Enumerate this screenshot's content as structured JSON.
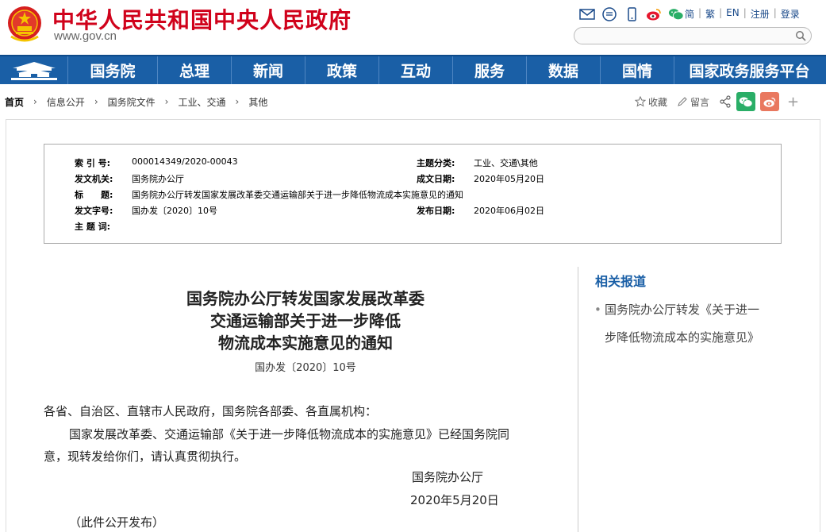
{
  "header": {
    "site_title": "中华人民共和国中央人民政府",
    "site_url": "www.gov.cn",
    "links": [
      "简",
      "繁",
      "EN",
      "注册",
      "登录"
    ],
    "icons": [
      "mail-icon",
      "message-icon",
      "mobile-icon",
      "weibo-icon",
      "wechat-icon"
    ]
  },
  "nav": {
    "items": [
      "国务院",
      "总理",
      "新闻",
      "政策",
      "互动",
      "服务",
      "数据",
      "国情",
      "国家政务服务平台"
    ]
  },
  "breadcrumb": {
    "items": [
      "首页",
      "信息公开",
      "国务院文件",
      "工业、交通",
      "其他"
    ]
  },
  "share": {
    "favorite": "收藏",
    "comment": "留言"
  },
  "info": {
    "index_label": "索 引 号:",
    "index_value": "000014349/2020-00043",
    "category_label": "主题分类:",
    "category_value": "工业、交通\\其他",
    "issuer_label": "发文机关:",
    "issuer_value": "国务院办公厅",
    "created_label": "成文日期:",
    "created_value": "2020年05月20日",
    "title_label": "标　　题:",
    "title_value": "国务院办公厅转发国家发展改革委交通运输部关于进一步降低物流成本实施意见的通知",
    "docno_label": "发文字号:",
    "docno_value": "国办发〔2020〕10号",
    "published_label": "发布日期:",
    "published_value": "2020年06月02日",
    "keywords_label": "主 题 词:",
    "keywords_value": ""
  },
  "article": {
    "title_line1": "国务院办公厅转发国家发展改革委",
    "title_line2": "交通运输部关于进一步降低",
    "title_line3": "物流成本实施意见的通知",
    "doc_number": "国办发〔2020〕10号",
    "salutation": "各省、自治区、直辖市人民政府，国务院各部委、各直属机构：",
    "body_line1": "国家发展改革委、交通运输部《关于进一步降低物流成本的实施意见》已经国务院同",
    "body_line2": "意，现转发给你们，请认真贯彻执行。",
    "signature": "国务院办公厅",
    "date": "2020年5月20日",
    "note": "（此件公开发布）"
  },
  "sidebar": {
    "title": "相关报道",
    "item_line1": "国务院办公厅转发《关于进一",
    "item_line2": "步降低物流成本的实施意见》"
  },
  "colors": {
    "brand_red": "#d0021b",
    "nav_blue": "#1a5fa6",
    "link_blue": "#1a4a8a"
  }
}
